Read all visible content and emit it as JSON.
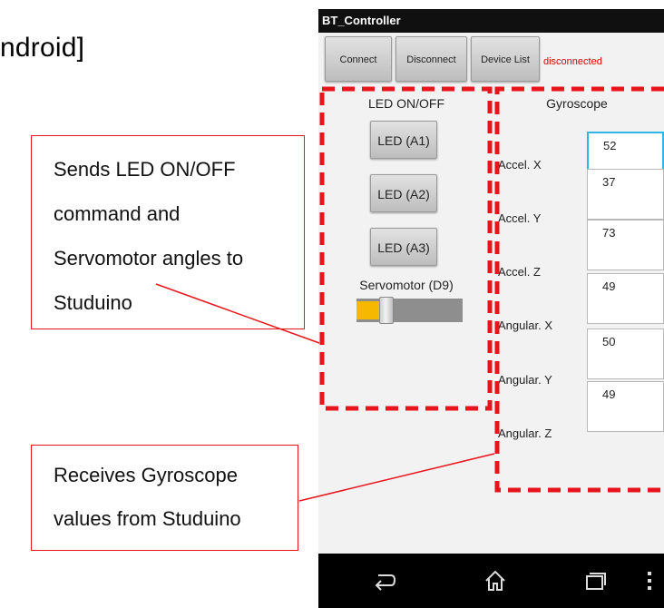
{
  "doc": {
    "heading": "ndroid]",
    "callout_send": {
      "lines": [
        "Sends LED ON/OFF",
        "command and",
        "Servomotor angles to",
        "Studuino"
      ]
    },
    "callout_receive": {
      "lines": [
        "Receives Gyroscope",
        "values from Studuino"
      ]
    },
    "accent_color": "#e8141b"
  },
  "app": {
    "title": "BT_Controller",
    "toolbar": {
      "connect_label": "Connect",
      "disconnect_label": "Disconnect",
      "device_list_label": "Device List",
      "status": "disconnected",
      "status_color": "#e00000"
    },
    "led": {
      "section_label": "LED ON/OFF",
      "buttons": [
        {
          "label": "LED (A1)"
        },
        {
          "label": "LED (A2)"
        },
        {
          "label": "LED (A3)"
        }
      ]
    },
    "servo": {
      "label": "Servomotor (D9)",
      "value_fraction": 0.28,
      "fill_color": "#f6b800"
    },
    "gyro": {
      "section_label": "Gyroscope",
      "rows": [
        {
          "label": "Accel. X",
          "value": "52",
          "focused": true
        },
        {
          "label": "Accel. Y",
          "value": "37",
          "focused": false
        },
        {
          "label": "Accel. Z",
          "value": "73",
          "focused": false
        },
        {
          "label": "Angular. X",
          "value": "49",
          "focused": false
        },
        {
          "label": "Angular. Y",
          "value": "50",
          "focused": false
        },
        {
          "label": "Angular. Z",
          "value": "49",
          "focused": false
        }
      ]
    },
    "navbar": {
      "icons": [
        "back-icon",
        "home-icon",
        "recent-apps-icon",
        "overflow-menu-icon"
      ]
    }
  }
}
